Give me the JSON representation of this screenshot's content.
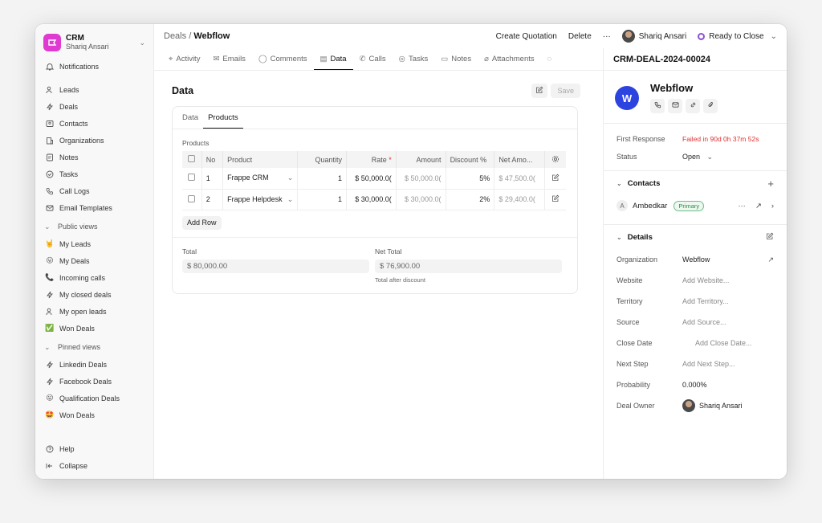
{
  "sidebar": {
    "brand_name": "CRM",
    "brand_user": "Shariq Ansari",
    "main_items": [
      {
        "label": "Notifications"
      },
      {
        "label": "Leads"
      },
      {
        "label": "Deals"
      },
      {
        "label": "Contacts"
      },
      {
        "label": "Organizations"
      },
      {
        "label": "Notes"
      },
      {
        "label": "Tasks"
      },
      {
        "label": "Call Logs"
      },
      {
        "label": "Email Templates"
      }
    ],
    "public_views_label": "Public views",
    "public_views": [
      {
        "label": "My Leads",
        "emoji": "🤘"
      },
      {
        "label": "My Deals",
        "emoji": "😛"
      },
      {
        "label": "Incoming calls",
        "emoji": "📞"
      },
      {
        "label": "My closed deals"
      },
      {
        "label": "My open leads"
      },
      {
        "label": "Won Deals",
        "emoji": "✅"
      }
    ],
    "pinned_views_label": "Pinned views",
    "pinned_views": [
      {
        "label": "Linkedin Deals"
      },
      {
        "label": "Facebook Deals"
      },
      {
        "label": "Qualification Deals",
        "emoji": "😛"
      },
      {
        "label": "Won Deals",
        "emoji": "🤩"
      }
    ],
    "help": "Help",
    "collapse": "Collapse"
  },
  "header": {
    "breadcrumb_parent": "Deals",
    "breadcrumb_sep": "/",
    "breadcrumb_current": "Webflow",
    "create_quotation": "Create Quotation",
    "delete": "Delete",
    "more": "···",
    "user": "Shariq Ansari",
    "status": "Ready to Close"
  },
  "tabs": [
    "Activity",
    "Emails",
    "Comments",
    "Data",
    "Calls",
    "Tasks",
    "Notes",
    "Attachments"
  ],
  "panel": {
    "title": "Data",
    "save": "Save",
    "card_tabs": [
      "Data",
      "Products"
    ],
    "products_label": "Products",
    "columns": [
      "No",
      "Product",
      "Quantity",
      "Rate",
      "Amount",
      "Discount %",
      "Net Amo..."
    ],
    "rate_required": "*",
    "rows": [
      {
        "no": "1",
        "product": "Frappe CRM",
        "quantity": "1",
        "rate": "$ 50,000.0(",
        "amount": "$ 50,000.0(",
        "discount": "5%",
        "net": "$ 47,500.0("
      },
      {
        "no": "2",
        "product": "Frappe Helpdesk",
        "quantity": "1",
        "rate": "$ 30,000.0(",
        "amount": "$ 30,000.0(",
        "discount": "2%",
        "net": "$ 29,400.0("
      }
    ],
    "add_row": "Add Row",
    "total_label": "Total",
    "total_value": "$ 80,000.00",
    "net_total_label": "Net Total",
    "net_total_value": "$ 76,900.00",
    "net_total_hint": "Total after discount"
  },
  "deal": {
    "id": "CRM-DEAL-2024-00024",
    "org_name": "Webflow",
    "org_logo_letter": "W",
    "first_response_label": "First Response",
    "first_response_value": "Failed in 90d 0h 37m 52s",
    "status_label": "Status",
    "status_value": "Open",
    "contacts_label": "Contacts",
    "contact": {
      "initial": "A",
      "name": "Ambedkar",
      "badge": "Primary"
    },
    "details_label": "Details",
    "details": [
      {
        "label": "Organization",
        "value": "Webflow"
      },
      {
        "label": "Website",
        "value": "Add Website..."
      },
      {
        "label": "Territory",
        "value": "Add Territory..."
      },
      {
        "label": "Source",
        "value": "Add Source..."
      },
      {
        "label": "Close Date",
        "value": "Add Close Date..."
      },
      {
        "label": "Next Step",
        "value": "Add Next Step..."
      },
      {
        "label": "Probability",
        "value": "0.000%"
      },
      {
        "label": "Deal Owner",
        "value": "Shariq Ansari"
      }
    ]
  },
  "colors": {
    "brand": "#e03bd0",
    "status_ring": "#8b4fd8",
    "org_logo": "#2d43e0",
    "error": "#e03131",
    "primary_badge": "#2a8a4a"
  }
}
